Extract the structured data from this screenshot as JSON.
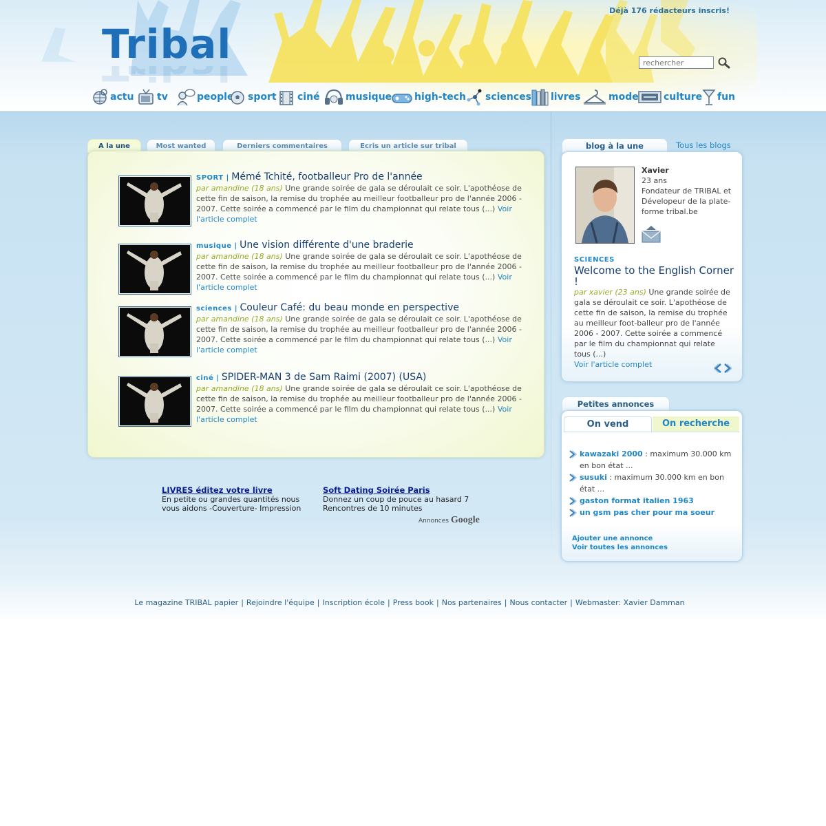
{
  "header": {
    "logo_text": "Tribal",
    "writers_count": "Déjà 176 rédacteurs inscris!",
    "search_placeholder": "rechercher"
  },
  "nav": [
    {
      "label": "actu",
      "icon": "globe-icon"
    },
    {
      "label": "tv",
      "icon": "tv-icon"
    },
    {
      "label": "people",
      "icon": "people-icon"
    },
    {
      "label": "sport",
      "icon": "football-icon"
    },
    {
      "label": "ciné",
      "icon": "film-icon"
    },
    {
      "label": "musique",
      "icon": "headphones-icon"
    },
    {
      "label": "high-tech",
      "icon": "gamepad-icon"
    },
    {
      "label": "sciences",
      "icon": "molecule-icon"
    },
    {
      "label": "livres",
      "icon": "books-icon"
    },
    {
      "label": "mode",
      "icon": "hanger-icon"
    },
    {
      "label": "culture",
      "icon": "ticket-icon"
    },
    {
      "label": "fun",
      "icon": "cocktail-icon"
    }
  ],
  "tabs": [
    {
      "label": "A la une",
      "active": true
    },
    {
      "label": "Most wanted",
      "active": false
    },
    {
      "label": "Derniers commentaires",
      "active": false
    },
    {
      "label": "Ecris un article sur tribal",
      "active": false
    }
  ],
  "articles": [
    {
      "category": "SPORT |",
      "title": "Mémé Tchité, footballeur Pro de l'année",
      "author": "par amandine (18 ans)",
      "excerpt": "Une grande soirée de gala se déroulait ce soir. L'apothéose de cette fin de saison, la remise du trophée au meilleur footballeur pro de l'année 2006 - 2007. Cette soirée a commencé par le film du championnat qui relate tous (...)",
      "link": "Voir l'article complet"
    },
    {
      "category": "musique |",
      "title": "Une vision différente d'une braderie",
      "author": "par amandine (18 ans)",
      "excerpt": "Une grande soirée de gala se déroulait ce soir. L'apothéose de cette fin de saison, la remise du trophée au meilleur footballeur pro de l'année 2006 - 2007. Cette soirée a commencé par le film du championnat qui relate tous (...)",
      "link": "Voir l'article complet"
    },
    {
      "category": "sciences |",
      "title": "Couleur Café: du beau monde en perspective",
      "author": "par amandine (18 ans)",
      "excerpt": "Une grande soirée de gala se déroulait ce soir. L'apothéose de cette fin de saison, la remise du trophée au meilleur footballeur pro de l'année 2006 - 2007. Cette soirée a commencé par le film du championnat qui relate tous (...)",
      "link": "Voir l'article complet"
    },
    {
      "category": "ciné |",
      "title": "SPIDER-MAN 3 de Sam Raimi (2007) (USA)",
      "author": "par amandine (18 ans)",
      "excerpt": "Une grande soirée de gala se déroulait ce soir. L'apothéose de cette fin de saison, la remise du trophée au meilleur footballeur pro de l'année 2006 - 2007. Cette soirée a commencé par le film du championnat qui relate tous (...)",
      "link": "Voir l'article complet"
    }
  ],
  "ads": [
    {
      "title": "LIVRES éditez votre livre",
      "line1": "En petite ou grandes quantités nous",
      "line2": "vous aidons -Couverture- Impression"
    },
    {
      "title": "Soft Dating Soirée Paris",
      "line1": "Donnez un coup de pouce au hasard 7",
      "line2": "Rencontres de 10 minutes"
    }
  ],
  "google_ads": {
    "prefix": "Annonces",
    "brand": "Google"
  },
  "blog": {
    "tab_label": "blog à la une",
    "all_blogs": "Tous les blogs",
    "name": "Xavier",
    "age": "23 ans",
    "bio": "Fondateur de TRIBAL et Dévelopeur de la plate-forme tribal.be",
    "category": "SCIENCES",
    "title": "Welcome to the English Corner !",
    "author": "par xavier (23 ans)",
    "excerpt": "Une grande soirée de gala se déroulait ce soir. L'apothéose de cette fin de saison, la remise du trophée au meilleur foot-balleur pro de l'année 2006 - 2007. Cette soirée a commencé par le film du championnat qui relate tous (...)",
    "link": "Voir l'article complet"
  },
  "annonces": {
    "tab_label": "Petites annonces",
    "tab_sell": "On vend",
    "tab_search": "On recherche",
    "items": [
      {
        "name": "kawazaki 2000",
        "desc": ": maximum 30.000 km en bon état ..."
      },
      {
        "name": "susuki",
        "desc": ": maximum 30.000 km en bon état ..."
      },
      {
        "name": "gaston format italien 1963",
        "desc": ""
      },
      {
        "name": "un gsm pas cher pour ma soeur",
        "desc": ""
      }
    ],
    "add_link": "Ajouter une annonce",
    "all_link": "Voir toutes les annonces"
  },
  "footer": [
    "Le magazine TRIBAL papier",
    "Rejoindre l'équipe",
    "Inscription école",
    "Press book",
    "Nos partenaires",
    "Nous contacter",
    "Webmaster: Xavier Damman"
  ],
  "colors": {
    "accent": "#1f86c6",
    "title": "#163f72",
    "author": "#9aa82a",
    "crowd": "#f5e15c"
  }
}
